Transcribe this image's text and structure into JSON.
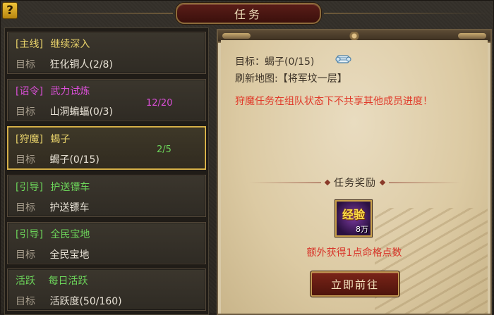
{
  "window": {
    "title": "任务",
    "help_label": "?"
  },
  "quests": [
    {
      "tag": "[主线]",
      "name": "继续深入",
      "target_label": "目标",
      "target": "狂化铜人(2/8)",
      "progress": "",
      "color": "#e8d26a"
    },
    {
      "tag": "[诏令]",
      "name": "武力试炼",
      "target_label": "目标",
      "target": "山洞蝙蝠(0/3)",
      "progress": "12/20",
      "color": "#d94fd6"
    },
    {
      "tag": "[狩魔]",
      "name": "蝎子",
      "target_label": "目标",
      "target": "蝎子(0/15)",
      "progress": "2/5",
      "color": "#e8d26a"
    },
    {
      "tag": "[引导]",
      "name": "护送镖车",
      "target_label": "目标",
      "target": "护送镖车",
      "progress": "",
      "color": "#6cd45a"
    },
    {
      "tag": "[引导]",
      "name": "全民宝地",
      "target_label": "目标",
      "target": "全民宝地",
      "progress": "",
      "color": "#6cd45a"
    },
    {
      "tag": "活跃",
      "name": "每日活跃",
      "target_label": "目标",
      "target": "活跃度(50/160)",
      "progress": "",
      "color": "#6cd45a"
    }
  ],
  "detail": {
    "target": "目标：蝎子(0/15)",
    "map": "刷新地图:【将军坟一层】",
    "warning": "狩魔任务在组队状态下不共享其他成员进度！",
    "reward_header": "任务奖励",
    "reward_item": {
      "name": "经验",
      "amount": "8万"
    },
    "extra": "额外获得1点命格点数",
    "go_button": "立即前往"
  }
}
